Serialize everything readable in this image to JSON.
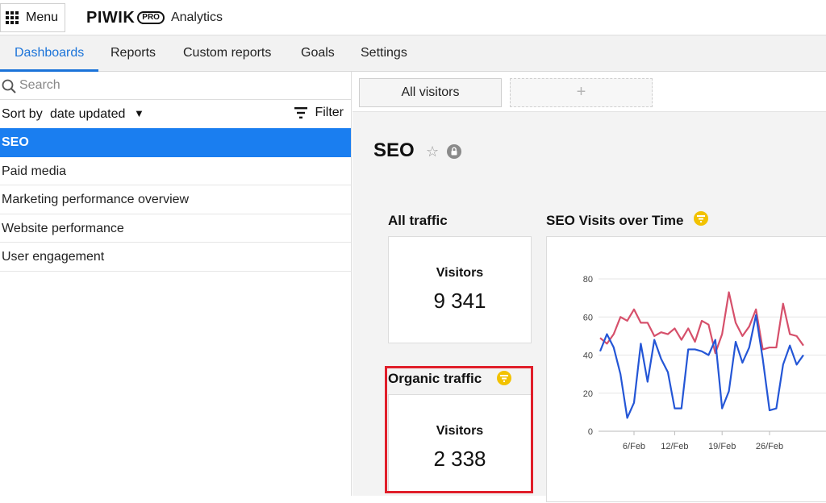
{
  "header": {
    "menu_label": "Menu",
    "brand_word": "PIWIK",
    "brand_pro": "PRO",
    "brand_app": "Analytics"
  },
  "nav": {
    "tabs": [
      {
        "label": "Dashboards",
        "active": true
      },
      {
        "label": "Reports",
        "active": false
      },
      {
        "label": "Custom reports",
        "active": false
      },
      {
        "label": "Goals",
        "active": false
      },
      {
        "label": "Settings",
        "active": false
      }
    ]
  },
  "sidebar": {
    "search_placeholder": "Search",
    "sort_label": "Sort by",
    "sort_value": "date updated",
    "filter_label": "Filter",
    "items": [
      {
        "label": "SEO",
        "active": true
      },
      {
        "label": "Paid media",
        "active": false
      },
      {
        "label": "Marketing performance overview",
        "active": false
      },
      {
        "label": "Website performance",
        "active": false
      },
      {
        "label": "User engagement",
        "active": false
      }
    ]
  },
  "segments": {
    "all_visitors": "All visitors",
    "add": "+"
  },
  "dashboard": {
    "title": "SEO",
    "widgets": {
      "all_traffic": {
        "title": "All traffic",
        "metric_label": "Visitors",
        "metric_value": "9 341"
      },
      "organic_traffic": {
        "title": "Organic traffic",
        "metric_label": "Visitors",
        "metric_value": "2 338"
      },
      "seo_visits": {
        "title": "SEO Visits over Time"
      }
    }
  },
  "colors": {
    "accent": "#1a73d9",
    "active_item": "#1a7ef0",
    "highlight": "#e01e2a",
    "filter_badge": "#f2c200",
    "series_pink": "#d6506b",
    "series_blue": "#2456d6"
  },
  "chart_data": {
    "type": "line",
    "title": "SEO Visits over Time",
    "ylim": [
      0,
      80
    ],
    "yticks": [
      0,
      20,
      40,
      60,
      80
    ],
    "xtick_labels": [
      "6/Feb",
      "12/Feb",
      "19/Feb",
      "26/Feb"
    ],
    "grid": true,
    "x": [
      "1/Feb",
      "2/Feb",
      "3/Feb",
      "4/Feb",
      "5/Feb",
      "6/Feb",
      "7/Feb",
      "8/Feb",
      "9/Feb",
      "10/Feb",
      "11/Feb",
      "12/Feb",
      "13/Feb",
      "14/Feb",
      "15/Feb",
      "16/Feb",
      "17/Feb",
      "18/Feb",
      "19/Feb",
      "20/Feb",
      "21/Feb",
      "22/Feb",
      "23/Feb",
      "24/Feb",
      "25/Feb",
      "26/Feb",
      "27/Feb",
      "28/Feb",
      "1/Mar",
      "2/Mar",
      "3/Mar"
    ],
    "series": [
      {
        "color": "#d6506b",
        "values": [
          49,
          46,
          51,
          60,
          58,
          64,
          57,
          57,
          50,
          52,
          51,
          54,
          48,
          54,
          47,
          58,
          56,
          41,
          51,
          73,
          57,
          50,
          55,
          64,
          43,
          44,
          44,
          67,
          51,
          50,
          45
        ]
      },
      {
        "color": "#2456d6",
        "values": [
          42,
          51,
          44,
          30,
          7,
          15,
          46,
          26,
          48,
          38,
          31,
          12,
          12,
          43,
          43,
          42,
          40,
          48,
          12,
          21,
          47,
          36,
          44,
          61,
          38,
          11,
          12,
          35,
          45,
          35,
          40
        ]
      }
    ]
  }
}
